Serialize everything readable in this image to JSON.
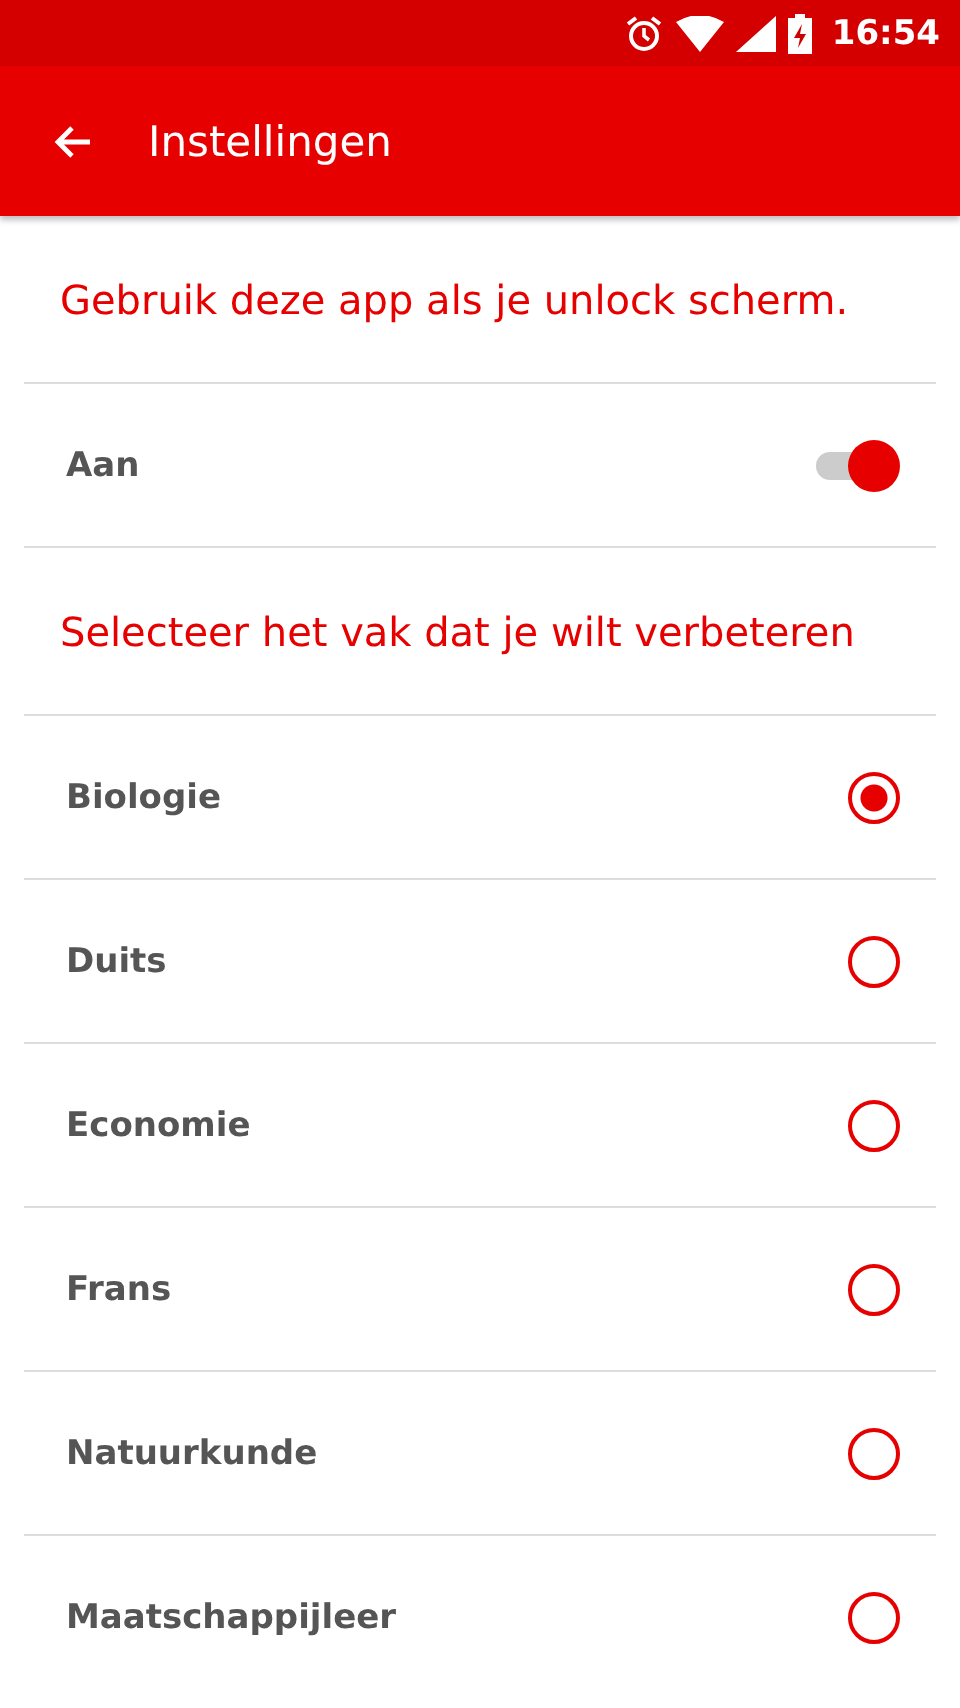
{
  "status_bar": {
    "time": "16:54"
  },
  "app_bar": {
    "title": "Instellingen"
  },
  "sections": [
    {
      "header": "Gebruik deze app als je unlock scherm.",
      "rows": [
        {
          "kind": "switch",
          "label": "Aan",
          "on": true
        }
      ]
    },
    {
      "header": "Selecteer het vak dat je wilt verbeteren",
      "rows": [
        {
          "kind": "radio",
          "label": "Biologie",
          "selected": true
        },
        {
          "kind": "radio",
          "label": "Duits",
          "selected": false
        },
        {
          "kind": "radio",
          "label": "Economie",
          "selected": false
        },
        {
          "kind": "radio",
          "label": "Frans",
          "selected": false
        },
        {
          "kind": "radio",
          "label": "Natuurkunde",
          "selected": false
        },
        {
          "kind": "radio",
          "label": "Maatschappijleer",
          "selected": false
        }
      ]
    }
  ]
}
